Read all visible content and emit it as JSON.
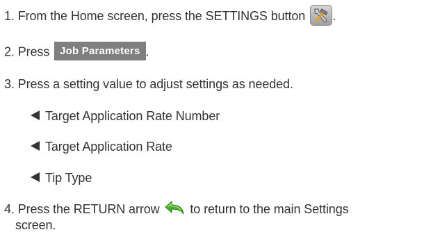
{
  "steps": {
    "step1": {
      "text": "1. From the Home screen, press the SETTINGS button",
      "suffix": ".",
      "icon": "settings-tools-icon"
    },
    "step2": {
      "prefix": "2. Press",
      "button_label": "Job Parameters",
      "suffix": "."
    },
    "step3": {
      "text": "3. Press a setting value to adjust settings as needed."
    },
    "settings_list": [
      "Target Application Rate Number",
      "Target Application Rate",
      "Tip Type"
    ],
    "step4": {
      "prefix": "4. Press the RETURN arrow",
      "icon": "return-arrow-icon",
      "suffix": "to return to the main Settings",
      "continuation": "screen."
    }
  },
  "colors": {
    "text": "#333333",
    "button_bg": "#7f7f7f",
    "button_text": "#ffffff",
    "return_arrow": "#4caf2a"
  }
}
